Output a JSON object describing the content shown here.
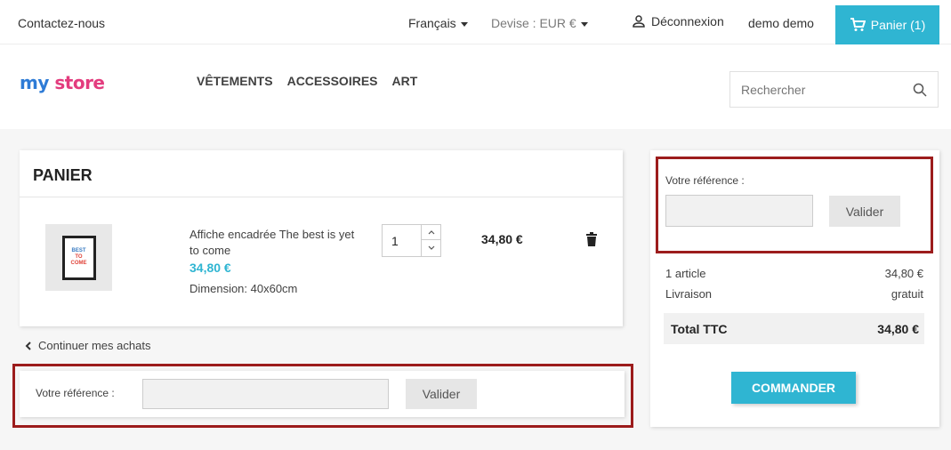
{
  "topbar": {
    "contact": "Contactez-nous",
    "language": "Français",
    "currency": "Devise : EUR €",
    "logout": "Déconnexion",
    "user_name": "demo demo",
    "cart_label": "Panier (1)"
  },
  "header": {
    "logo_part1": "my",
    "logo_part2": "store",
    "menu": [
      "VÊTEMENTS",
      "ACCESSOIRES",
      "ART"
    ],
    "search_placeholder": "Rechercher"
  },
  "cart": {
    "title": "PANIER",
    "item": {
      "name": "Affiche encadrée The best is yet to come",
      "price": "34,80 €",
      "attribute": "Dimension: 40x60cm",
      "quantity": "1",
      "line_total": "34,80 €",
      "poster_text": [
        "BEST",
        "TO",
        "COME"
      ]
    },
    "continue": "Continuer mes achats"
  },
  "reference_bottom": {
    "label": "Votre référence :",
    "button": "Valider"
  },
  "summary": {
    "reference_label": "Votre référence :",
    "reference_button": "Valider",
    "items_label": "1 article",
    "items_value": "34,80 €",
    "shipping_label": "Livraison",
    "shipping_value": "gratuit",
    "total_label": "Total TTC",
    "total_value": "34,80 €",
    "checkout": "COMMANDER"
  },
  "colors": {
    "accent": "#2fb5d2",
    "highlight": "#9c1c1c"
  }
}
